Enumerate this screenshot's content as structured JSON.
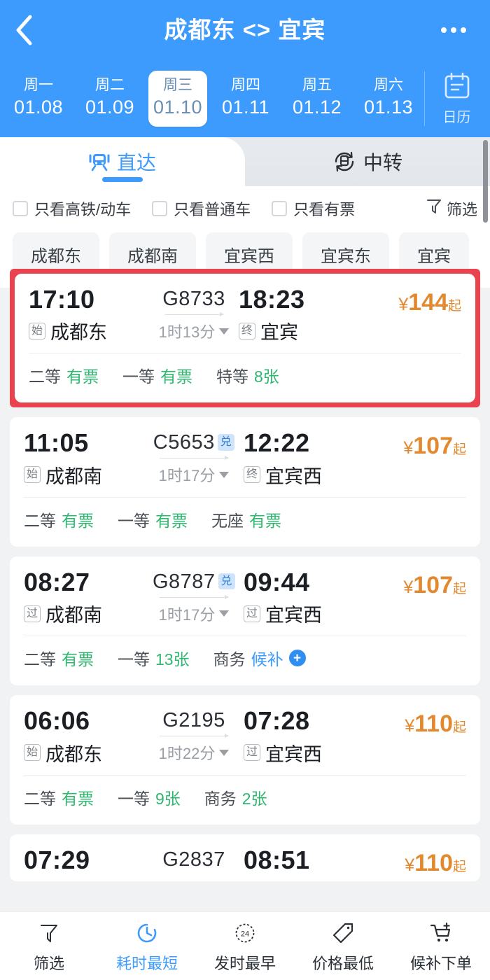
{
  "header": {
    "back_icon": "chevron-left-icon",
    "title": "成都东 <> 宜宾",
    "more_icon": "more-options-icon",
    "brand_color": "#3d9bfd",
    "dates": [
      {
        "dow": "周一",
        "date": "01.08",
        "active": false
      },
      {
        "dow": "周二",
        "date": "01.09",
        "active": false
      },
      {
        "dow": "周三",
        "date": "01.10",
        "active": true
      },
      {
        "dow": "周四",
        "date": "01.11",
        "active": false
      },
      {
        "dow": "周五",
        "date": "01.12",
        "active": false
      },
      {
        "dow": "周六",
        "date": "01.13",
        "active": false
      }
    ],
    "calendar_label": "日历",
    "calendar_icon": "calendar-icon"
  },
  "tabs": [
    {
      "label": "直达",
      "icon": "train-icon",
      "active": true
    },
    {
      "label": "中转",
      "icon": "transfer-train-icon",
      "active": false
    }
  ],
  "filters": {
    "checkboxes": [
      {
        "label": "只看高铁/动车",
        "checked": false
      },
      {
        "label": "只看普通车",
        "checked": false
      },
      {
        "label": "只看有票",
        "checked": false
      }
    ],
    "filter_button": {
      "label": "筛选",
      "icon": "funnel-icon"
    },
    "station_chips": [
      "成都东",
      "成都南",
      "宜宾西",
      "宜宾东",
      "宜宾"
    ]
  },
  "trains": [
    {
      "selected": true,
      "depart_time": "17:10",
      "depart_badge": "始",
      "depart_station": "成都东",
      "train_no": "G8733",
      "exchange_badge": "",
      "duration": "1时13分",
      "arrive_time": "18:23",
      "arrive_badge": "终",
      "arrive_station": "宜宾",
      "price_currency": "¥",
      "price": "144",
      "price_suffix": "起",
      "seats": [
        {
          "name": "二等",
          "value": "有票",
          "style": "green"
        },
        {
          "name": "一等",
          "value": "有票",
          "style": "green"
        },
        {
          "name": "特等",
          "value": "8张",
          "style": "green"
        }
      ]
    },
    {
      "selected": false,
      "depart_time": "11:05",
      "depart_badge": "始",
      "depart_station": "成都南",
      "train_no": "C5653",
      "exchange_badge": "兑",
      "duration": "1时17分",
      "arrive_time": "12:22",
      "arrive_badge": "终",
      "arrive_station": "宜宾西",
      "price_currency": "¥",
      "price": "107",
      "price_suffix": "起",
      "seats": [
        {
          "name": "二等",
          "value": "有票",
          "style": "green"
        },
        {
          "name": "一等",
          "value": "有票",
          "style": "green"
        },
        {
          "name": "无座",
          "value": "有票",
          "style": "green"
        }
      ]
    },
    {
      "selected": false,
      "depart_time": "08:27",
      "depart_badge": "过",
      "depart_station": "成都南",
      "train_no": "G8787",
      "exchange_badge": "兑",
      "duration": "1时17分",
      "arrive_time": "09:44",
      "arrive_badge": "过",
      "arrive_station": "宜宾西",
      "price_currency": "¥",
      "price": "107",
      "price_suffix": "起",
      "seats": [
        {
          "name": "二等",
          "value": "有票",
          "style": "green"
        },
        {
          "name": "一等",
          "value": "13张",
          "style": "green"
        },
        {
          "name": "商务",
          "value": "候补",
          "style": "blue-plus"
        }
      ]
    },
    {
      "selected": false,
      "depart_time": "06:06",
      "depart_badge": "始",
      "depart_station": "成都东",
      "train_no": "G2195",
      "exchange_badge": "",
      "duration": "1时22分",
      "arrive_time": "07:28",
      "arrive_badge": "过",
      "arrive_station": "宜宾西",
      "price_currency": "¥",
      "price": "110",
      "price_suffix": "起",
      "seats": [
        {
          "name": "二等",
          "value": "有票",
          "style": "green"
        },
        {
          "name": "一等",
          "value": "9张",
          "style": "green"
        },
        {
          "name": "商务",
          "value": "2张",
          "style": "green"
        }
      ]
    },
    {
      "selected": false,
      "partial": true,
      "depart_time": "07:29",
      "depart_badge": "",
      "depart_station": "",
      "train_no": "G2837",
      "exchange_badge": "",
      "duration": "",
      "arrive_time": "08:51",
      "arrive_badge": "",
      "arrive_station": "",
      "price_currency": "¥",
      "price": "110",
      "price_suffix": "起",
      "seats": []
    }
  ],
  "bottom_nav": [
    {
      "label": "筛选",
      "icon": "funnel-icon",
      "active": false
    },
    {
      "label": "耗时最短",
      "icon": "clock-icon",
      "active": true
    },
    {
      "label": "发时最早",
      "icon": "24hour-icon",
      "active": false
    },
    {
      "label": "价格最低",
      "icon": "price-tag-icon",
      "active": false
    },
    {
      "label": "候补下单",
      "icon": "cart-plus-icon",
      "active": false
    }
  ]
}
